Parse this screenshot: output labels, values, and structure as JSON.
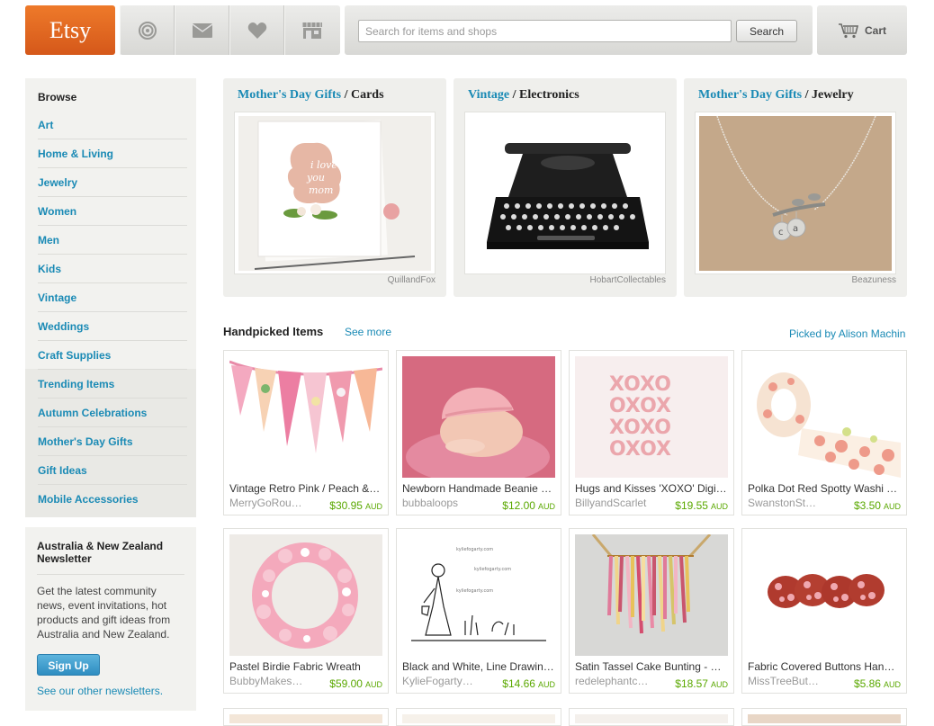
{
  "header": {
    "logo": "Etsy",
    "icons": [
      "activity-icon",
      "mail-icon",
      "heart-icon",
      "shop-icon"
    ],
    "search_placeholder": "Search for items and shops",
    "search_button": "Search",
    "cart_label": "Cart"
  },
  "sidebar": {
    "title": "Browse",
    "items": [
      {
        "label": "Art"
      },
      {
        "label": "Home & Living"
      },
      {
        "label": "Jewelry"
      },
      {
        "label": "Women"
      },
      {
        "label": "Men"
      },
      {
        "label": "Kids"
      },
      {
        "label": "Vintage"
      },
      {
        "label": "Weddings"
      },
      {
        "label": "Craft Supplies"
      },
      {
        "label": "Trending Items"
      },
      {
        "label": "Autumn Celebrations"
      },
      {
        "label": "Mother's Day Gifts"
      },
      {
        "label": "Gift Ideas"
      },
      {
        "label": "Mobile Accessories"
      }
    ]
  },
  "newsletter": {
    "title": "Australia & New Zealand Newsletter",
    "body": "Get the latest community news, event invitations, hot products and gift ideas from Australia and New Zealand.",
    "signup": "Sign Up",
    "other": "See our other newsletters."
  },
  "features": [
    {
      "category": "Mother's Day Gifts",
      "sub": "Cards",
      "credit": "QuillandFox"
    },
    {
      "category": "Vintage",
      "sub": "Electronics",
      "credit": "HobartCollectables"
    },
    {
      "category": "Mother's Day Gifts",
      "sub": "Jewelry",
      "credit": "Beazuness"
    }
  ],
  "handpicked": {
    "title": "Handpicked Items",
    "see_more": "See more",
    "picked_by": "Picked by Alison Machin",
    "items": [
      {
        "name": "Vintage Retro Pink / Peach & Orange Bunting",
        "shop": "MerryGoRou…",
        "price": "$30.95",
        "currency": "AUD"
      },
      {
        "name": "Newborn Handmade Beanie Hat",
        "shop": "bubbaloops",
        "price": "$12.00",
        "currency": "AUD"
      },
      {
        "name": "Hugs and Kisses 'XOXO' Digital Print",
        "shop": "BillyandScarlet",
        "price": "$19.55",
        "currency": "AUD"
      },
      {
        "name": "Polka Dot Red Spotty Washi Tape",
        "shop": "SwanstonSt…",
        "price": "$3.50",
        "currency": "AUD"
      },
      {
        "name": "Pastel Birdie Fabric Wreath",
        "shop": "BubbyMakes…",
        "price": "$59.00",
        "currency": "AUD"
      },
      {
        "name": "Black and White, Line Drawing Print",
        "shop": "KylieFogarty…",
        "price": "$14.66",
        "currency": "AUD"
      },
      {
        "name": "Satin Tassel Cake Bunting - Pink",
        "shop": "redelephantc…",
        "price": "$18.57",
        "currency": "AUD"
      },
      {
        "name": "Fabric Covered Buttons Handmade",
        "shop": "MissTreeBut…",
        "price": "$5.86",
        "currency": "AUD"
      }
    ]
  }
}
